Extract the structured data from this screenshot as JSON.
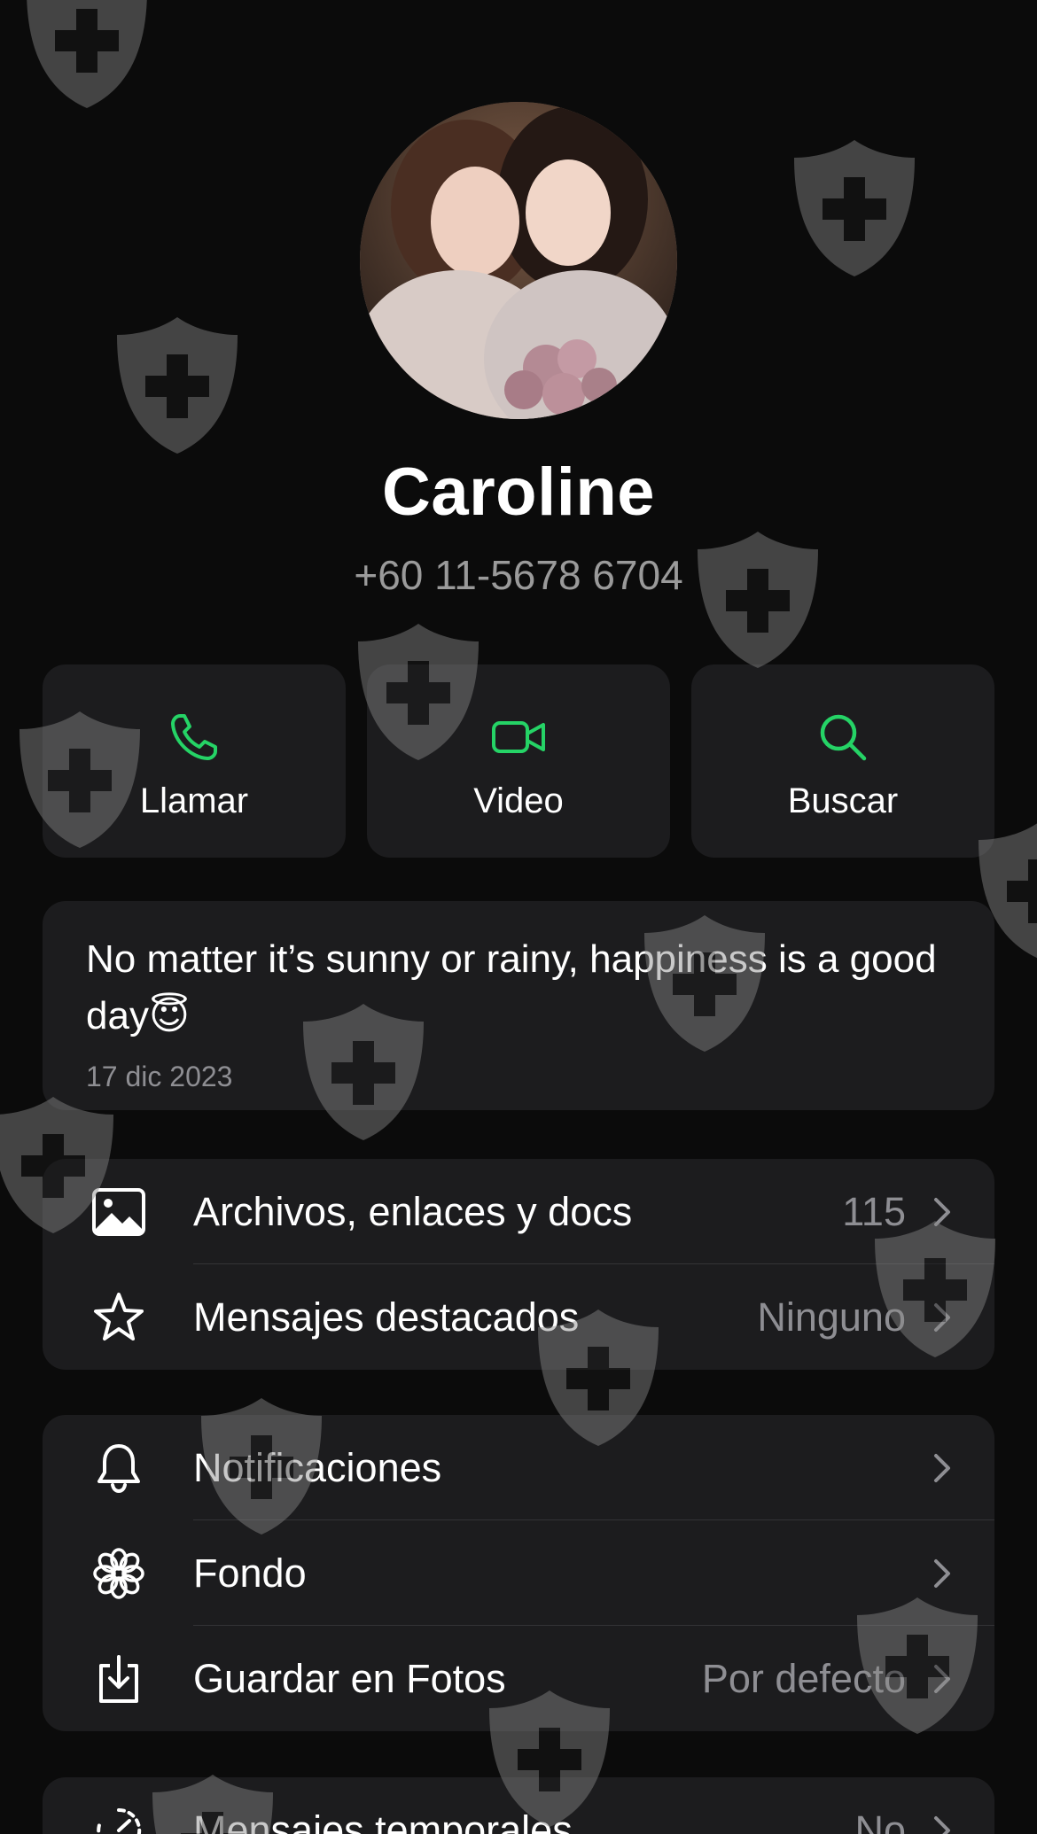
{
  "contact": {
    "name": "Caroline",
    "phone": "+60 11-5678 6704"
  },
  "actions": [
    {
      "label": "Llamar",
      "icon": "phone-icon"
    },
    {
      "label": "Video",
      "icon": "video-icon"
    },
    {
      "label": "Buscar",
      "icon": "search-icon"
    }
  ],
  "about": {
    "text": "No matter it’s sunny or rainy, happiness is a good day😇",
    "date": "17 dic 2023"
  },
  "media_group": [
    {
      "label": "Archivos, enlaces y docs",
      "value": "115",
      "icon": "image-icon"
    },
    {
      "label": "Mensajes destacados",
      "value": "Ninguno",
      "icon": "star-icon"
    }
  ],
  "settings_group": [
    {
      "label": "Notificaciones",
      "value": "",
      "icon": "bell-icon"
    },
    {
      "label": "Fondo",
      "value": "",
      "icon": "flower-icon"
    },
    {
      "label": "Guardar en Fotos",
      "value": "Por defecto",
      "icon": "download-icon"
    }
  ],
  "privacy_group": [
    {
      "label": "Mensajes temporales",
      "value": "No",
      "icon": "timer-icon"
    }
  ],
  "colors": {
    "background": "#0b0b0b",
    "card": "#1c1c1e",
    "accent": "#25d366",
    "secondary_text": "#8e8e93"
  }
}
